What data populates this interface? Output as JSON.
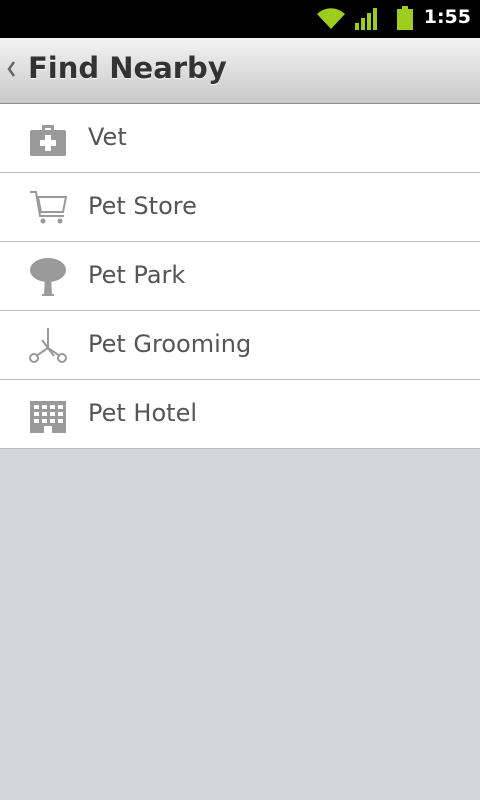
{
  "status_bar": {
    "time": "1:55",
    "icons": [
      "wifi-icon",
      "signal-icon",
      "battery-icon"
    ],
    "accent_color": "#9ccc1c"
  },
  "header": {
    "title": "Find Nearby",
    "back_icon": "chevron-left-icon"
  },
  "list": {
    "items": [
      {
        "label": "Vet",
        "icon": "first-aid-kit-icon"
      },
      {
        "label": "Pet Store",
        "icon": "shopping-cart-icon"
      },
      {
        "label": "Pet Park",
        "icon": "tree-icon"
      },
      {
        "label": "Pet Grooming",
        "icon": "scissors-icon"
      },
      {
        "label": "Pet Hotel",
        "icon": "building-icon"
      }
    ]
  },
  "colors": {
    "background": "#d4d5d7",
    "icon_gray": "#9a9a9a",
    "label_text": "#555555"
  }
}
